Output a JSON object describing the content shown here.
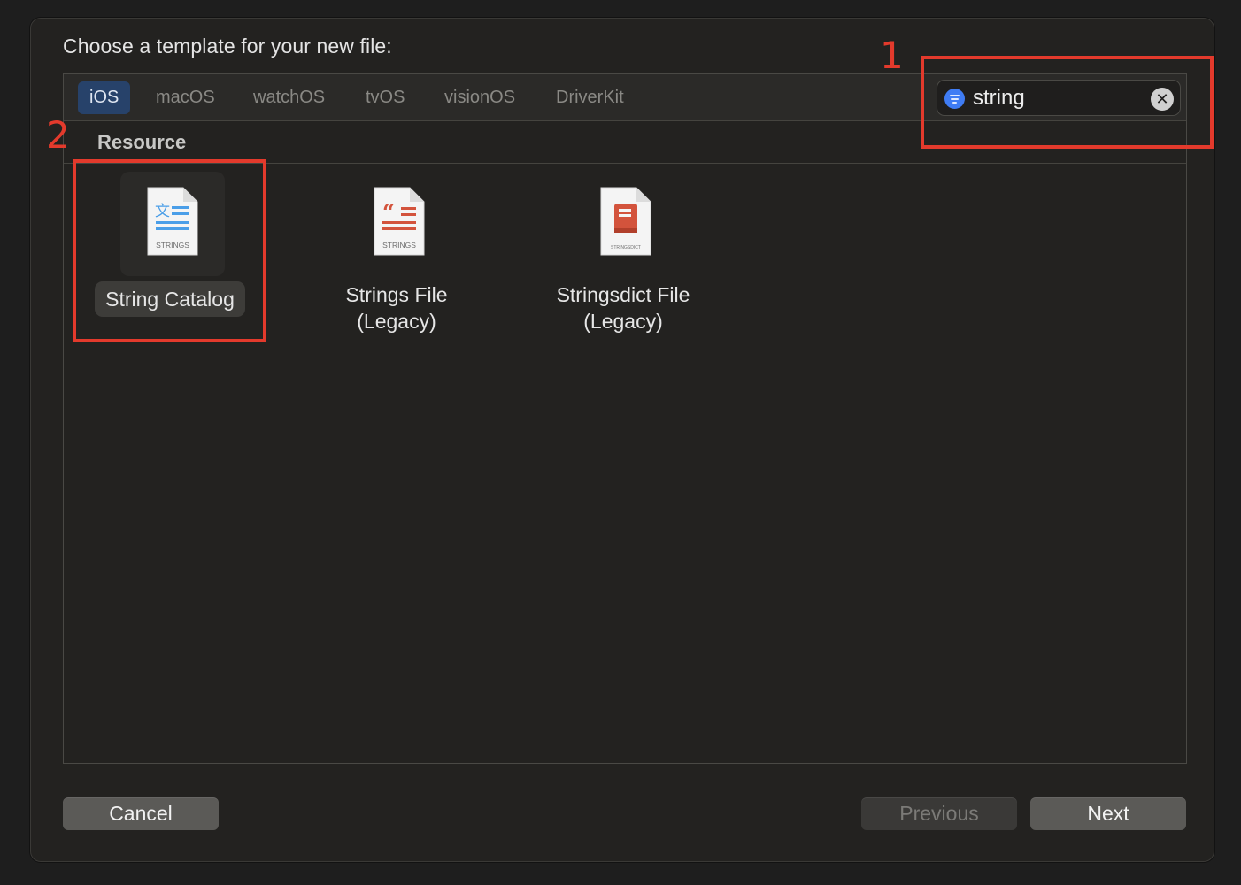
{
  "dialog": {
    "title": "Choose a template for your new file:"
  },
  "platform_tabs": [
    {
      "label": "iOS",
      "active": true
    },
    {
      "label": "macOS",
      "active": false
    },
    {
      "label": "watchOS",
      "active": false
    },
    {
      "label": "tvOS",
      "active": false
    },
    {
      "label": "visionOS",
      "active": false
    },
    {
      "label": "DriverKit",
      "active": false
    }
  ],
  "search": {
    "value": "string",
    "filter_icon": "line-3-horizontal-decrease-circle-fill",
    "clear_icon": "xmark-circle-fill"
  },
  "section": {
    "title": "Resource"
  },
  "templates": [
    {
      "label": "String Catalog",
      "icon_caption": "STRINGS",
      "icon": "string-catalog-icon",
      "selected": true
    },
    {
      "label": "Strings File\n(Legacy)",
      "icon_caption": "STRINGS",
      "icon": "strings-file-icon",
      "selected": false
    },
    {
      "label": "Stringsdict File\n(Legacy)",
      "icon_caption": "STRINGSDICT",
      "icon": "stringsdict-file-icon",
      "selected": false
    }
  ],
  "buttons": {
    "cancel": "Cancel",
    "previous": "Previous",
    "next": "Next"
  },
  "annotations": [
    "1",
    "2"
  ],
  "colors": {
    "accent_tab": "#27426a",
    "search_icon": "#3f7cf4",
    "annotation": "#e33a2c",
    "strings_blue": "#4a9ee8",
    "strings_red": "#d3533c"
  }
}
